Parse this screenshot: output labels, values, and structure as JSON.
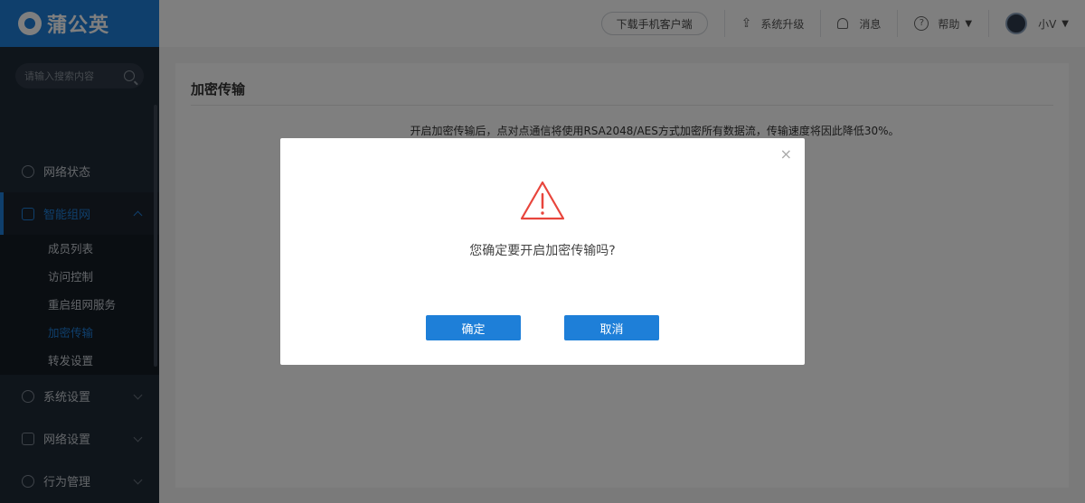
{
  "app": {
    "brand": "蒲公英"
  },
  "sidebar": {
    "search_placeholder": "请输入搜索内容",
    "items": [
      {
        "label": "网络状态",
        "icon": "network-status-icon"
      },
      {
        "label": "智能组网",
        "icon": "smart-network-icon",
        "expanded": true
      },
      {
        "label": "系统设置",
        "icon": "system-settings-icon"
      },
      {
        "label": "网络设置",
        "icon": "network-settings-icon"
      },
      {
        "label": "行为管理",
        "icon": "behavior-management-icon"
      }
    ],
    "submenu": [
      {
        "label": "成员列表"
      },
      {
        "label": "访问控制"
      },
      {
        "label": "重启组网服务"
      },
      {
        "label": "加密传输",
        "active": true
      },
      {
        "label": "转发设置"
      }
    ]
  },
  "topbar": {
    "download": "下载手机客户端",
    "upgrade": "系统升级",
    "messages": "消息",
    "help": "帮助",
    "help_glyph": "?",
    "user": "小V"
  },
  "main": {
    "title": "加密传输",
    "description": "开启加密传输后，点对点通信将使用RSA2048/AES方式加密所有数据流，传输速度将因此降低30%。"
  },
  "dialog": {
    "close": "×",
    "message": "您确定要开启加密传输吗?",
    "confirm": "确定",
    "cancel": "取消"
  },
  "colors": {
    "accent": "#1e7fd8",
    "warning": "#e8453c",
    "sidebar": "#1f2a37"
  }
}
